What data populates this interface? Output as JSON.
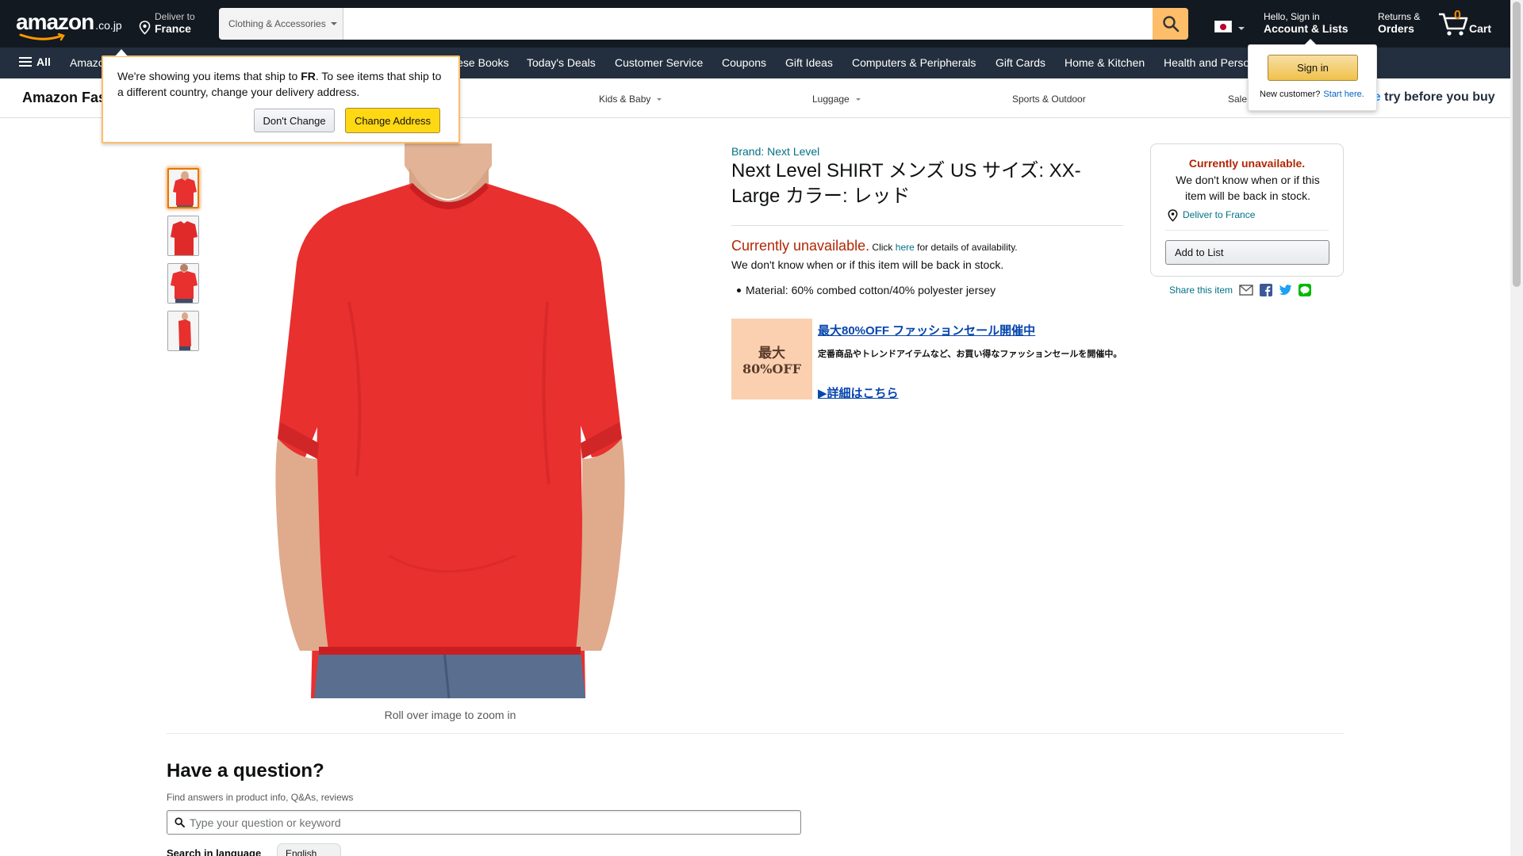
{
  "header": {
    "logo": "amazon",
    "logo_tld": ".co.jp",
    "deliver_small": "Deliver to",
    "deliver_big": "France",
    "search_category": "Clothing & Accessories",
    "search_placeholder": "",
    "account_small": "Hello, Sign in",
    "account_big": "Account & Lists",
    "orders_small": "Returns &",
    "orders_big": "Orders",
    "cart_count": "0",
    "cart_label": "Cart"
  },
  "subnav": {
    "all_label": "All",
    "items": [
      "Amazon",
      "Japanese Books",
      "Today's Deals",
      "Customer Service",
      "Coupons",
      "Gift Ideas",
      "Computers & Peripherals",
      "Gift Cards",
      "Home & Kitchen",
      "Health and Personal Care"
    ]
  },
  "store_strip": {
    "logo": "Amazon Fashion",
    "categories": [
      "Kids & Baby",
      "Luggage",
      "Sports & Outdoor",
      "Sale"
    ],
    "prime_prefix": "ne",
    "prime_text": " try before you buy"
  },
  "ship_popover": {
    "msg_pre": "We're showing you items that ship to ",
    "msg_country": "FR",
    "msg_post": ". To see items that ship to a different country, change your delivery address.",
    "dont_change": "Don't Change",
    "change_address": "Change Address"
  },
  "signin_popover": {
    "sign_in": "Sign in",
    "new_customer": "New customer?",
    "start_here": "Start here."
  },
  "product": {
    "brand": "Brand: Next Level",
    "title": "Next Level SHIRT メンズ US サイズ: XX-Large カラー: レッド",
    "unavailable_big": "Currently unavailable.",
    "click": " Click ",
    "here": "here",
    "details": " for details of availability.",
    "unavailable_sub": "We don't know when or if this item will be back in stock.",
    "bullet": "Material: 60% combed cotton/40% polyester jersey",
    "zoom_hint": "Roll over image to zoom in"
  },
  "promo": {
    "image_line1": "最大",
    "image_line2": "80%OFF",
    "headline": "最大80%OFF ファッションセール開催中",
    "body": "定番商品やトレンドアイテムなど、お買い得なファッションセールを開催中。",
    "link": "▶詳細はこちら"
  },
  "buybox": {
    "title": "Currently unavailable.",
    "text": "We don't know when or if this item will be back in stock.",
    "deliver": "Deliver to France",
    "add_to_list": "Add to List"
  },
  "share": {
    "label": "Share this item"
  },
  "qa": {
    "title": "Have a question?",
    "subtitle": "Find answers in product info, Q&As, reviews",
    "placeholder": "Type your question or keyword",
    "lang_label": "Search in language",
    "lang_value": "English"
  },
  "colors": {
    "nav_dark": "#131921",
    "nav_sub": "#232f3e",
    "search_btn": "#febd69",
    "link": "#007185",
    "unavailable": "#b12704",
    "shirt_red": "#e8302f"
  }
}
